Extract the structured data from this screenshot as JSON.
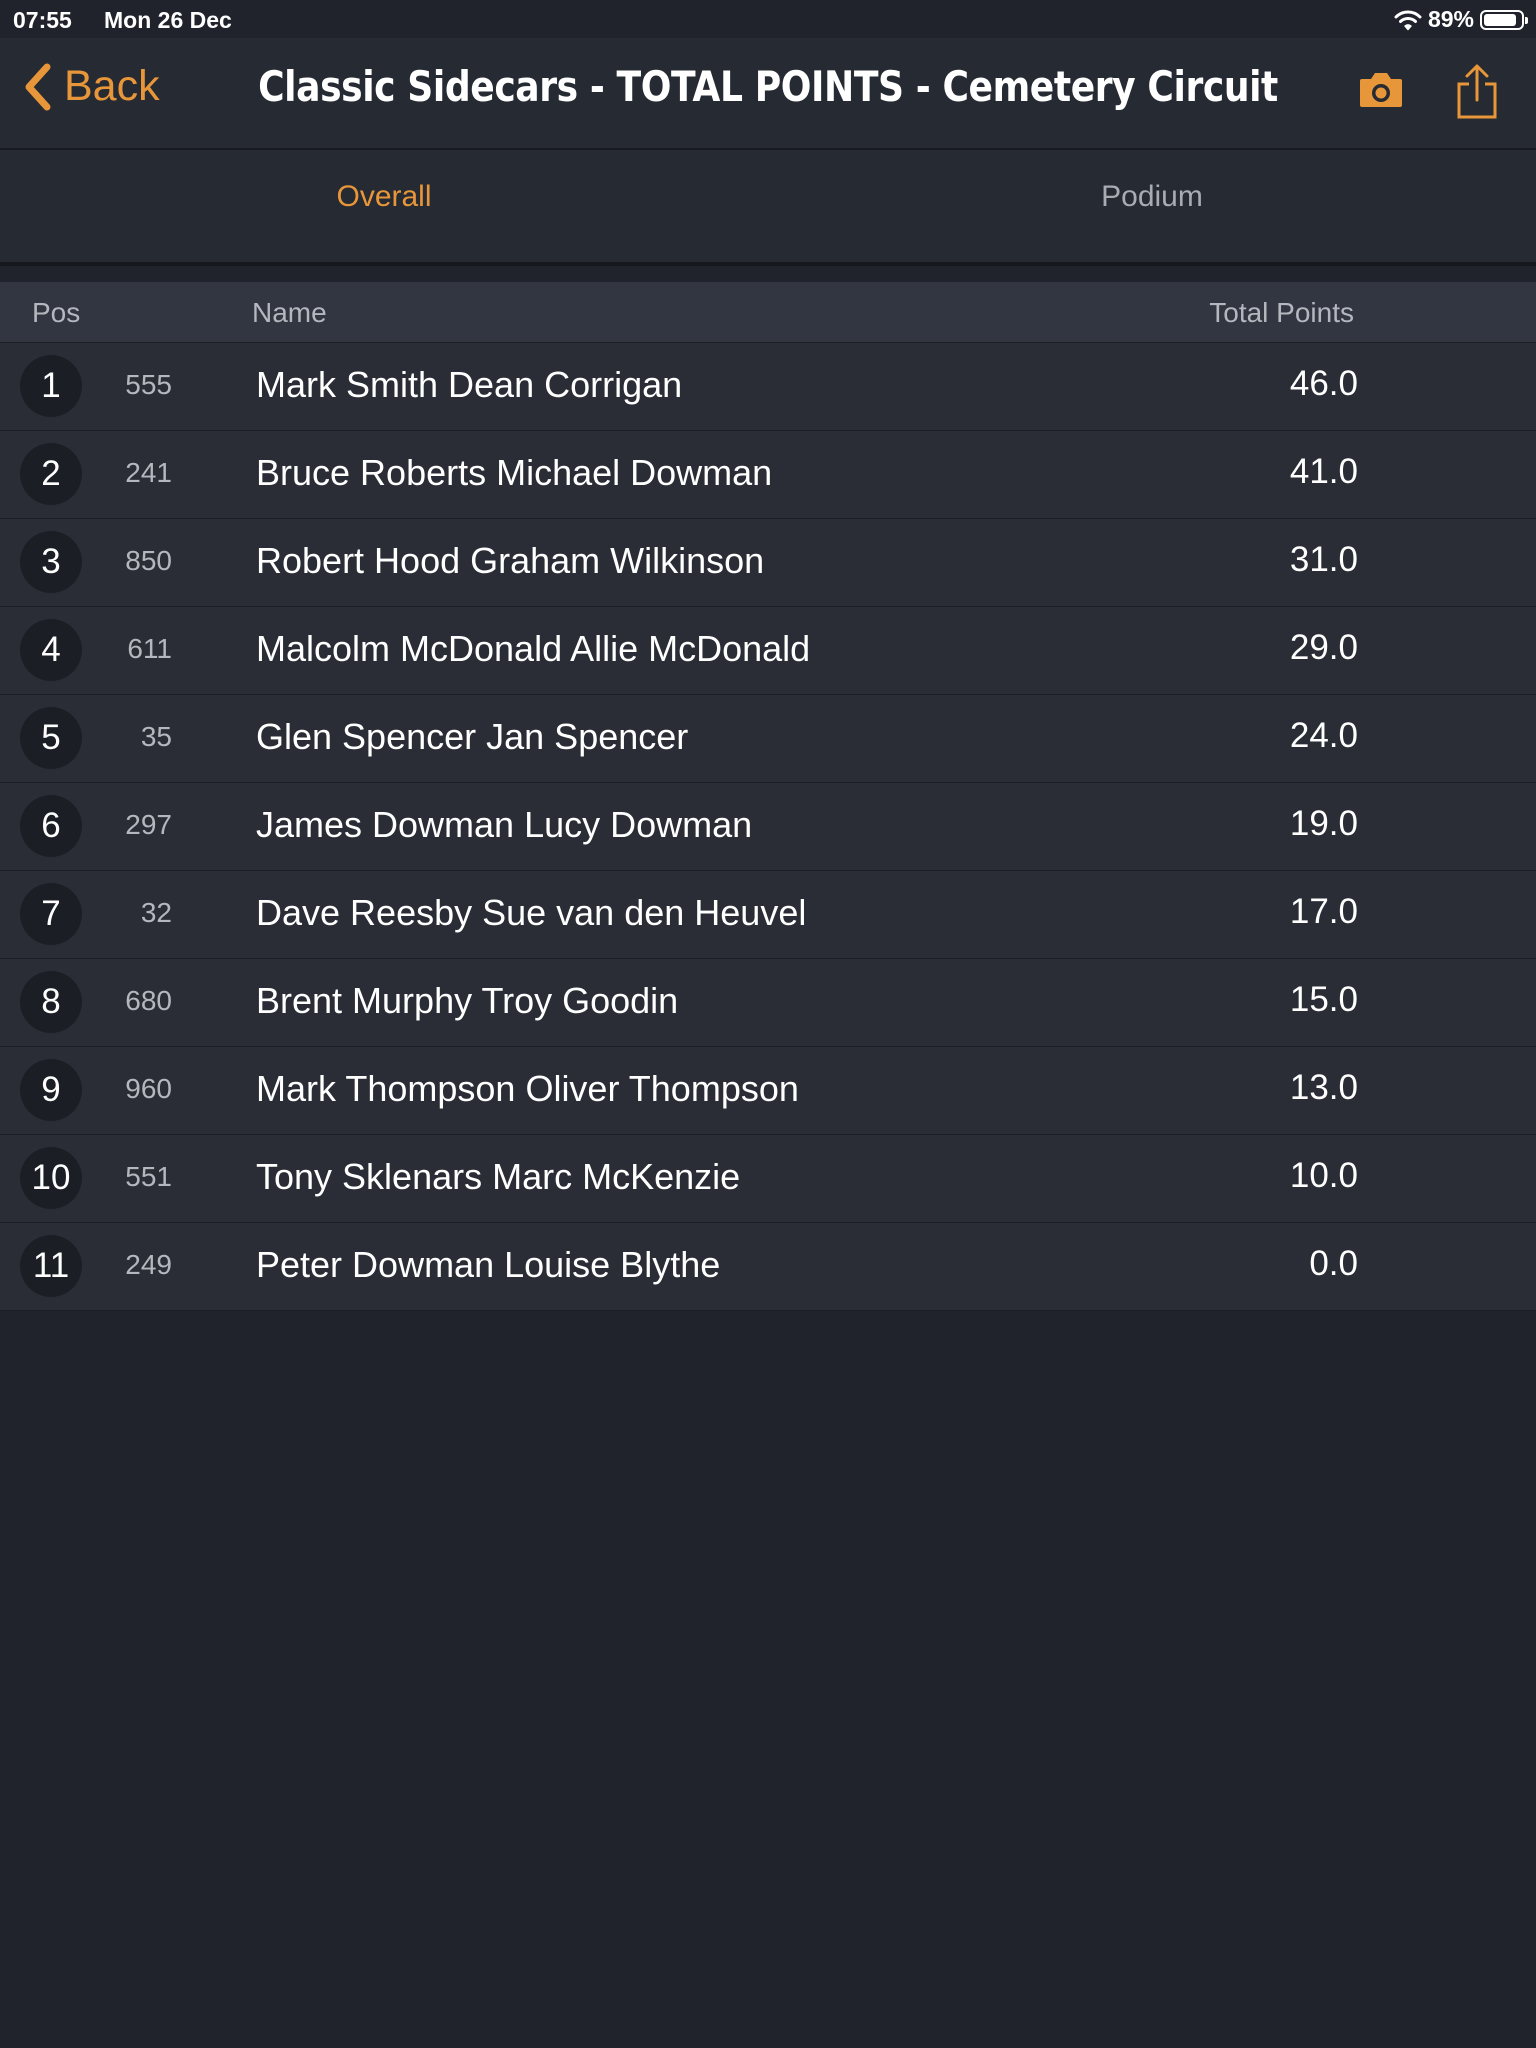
{
  "status": {
    "time": "07:55",
    "date": "Mon 26 Dec",
    "battery": "89%"
  },
  "nav": {
    "back_label": "Back",
    "title": "Classic Sidecars - TOTAL POINTS - Cemetery Circuit"
  },
  "tabs": {
    "overall": "Overall",
    "podium": "Podium",
    "active": "Overall"
  },
  "table": {
    "headers": {
      "pos": "Pos",
      "name": "Name",
      "points": "Total Points"
    },
    "rows": [
      {
        "pos": "1",
        "num": "555",
        "name": "Mark Smith Dean Corrigan",
        "points": "46.0"
      },
      {
        "pos": "2",
        "num": "241",
        "name": "Bruce Roberts Michael Dowman",
        "points": "41.0"
      },
      {
        "pos": "3",
        "num": "850",
        "name": "Robert Hood Graham Wilkinson",
        "points": "31.0"
      },
      {
        "pos": "4",
        "num": "611",
        "name": "Malcolm McDonald Allie McDonald",
        "points": "29.0"
      },
      {
        "pos": "5",
        "num": "35",
        "name": "Glen Spencer Jan Spencer",
        "points": "24.0"
      },
      {
        "pos": "6",
        "num": "297",
        "name": "James Dowman Lucy Dowman",
        "points": "19.0"
      },
      {
        "pos": "7",
        "num": "32",
        "name": "Dave Reesby Sue van den Heuvel",
        "points": "17.0"
      },
      {
        "pos": "8",
        "num": "680",
        "name": "Brent Murphy Troy Goodin",
        "points": "15.0"
      },
      {
        "pos": "9",
        "num": "960",
        "name": "Mark Thompson Oliver Thompson",
        "points": "13.0"
      },
      {
        "pos": "10",
        "num": "551",
        "name": "Tony Sklenars Marc McKenzie",
        "points": "10.0"
      },
      {
        "pos": "11",
        "num": "249",
        "name": "Peter Dowman Louise Blythe",
        "points": "0.0"
      }
    ]
  },
  "colors": {
    "accent": "#e8963a",
    "background": "#20232b",
    "row": "#2a2d36"
  },
  "icons": {
    "back": "chevron-left-icon",
    "camera": "camera-icon",
    "share": "share-icon",
    "wifi": "wifi-icon",
    "battery": "battery-icon"
  }
}
